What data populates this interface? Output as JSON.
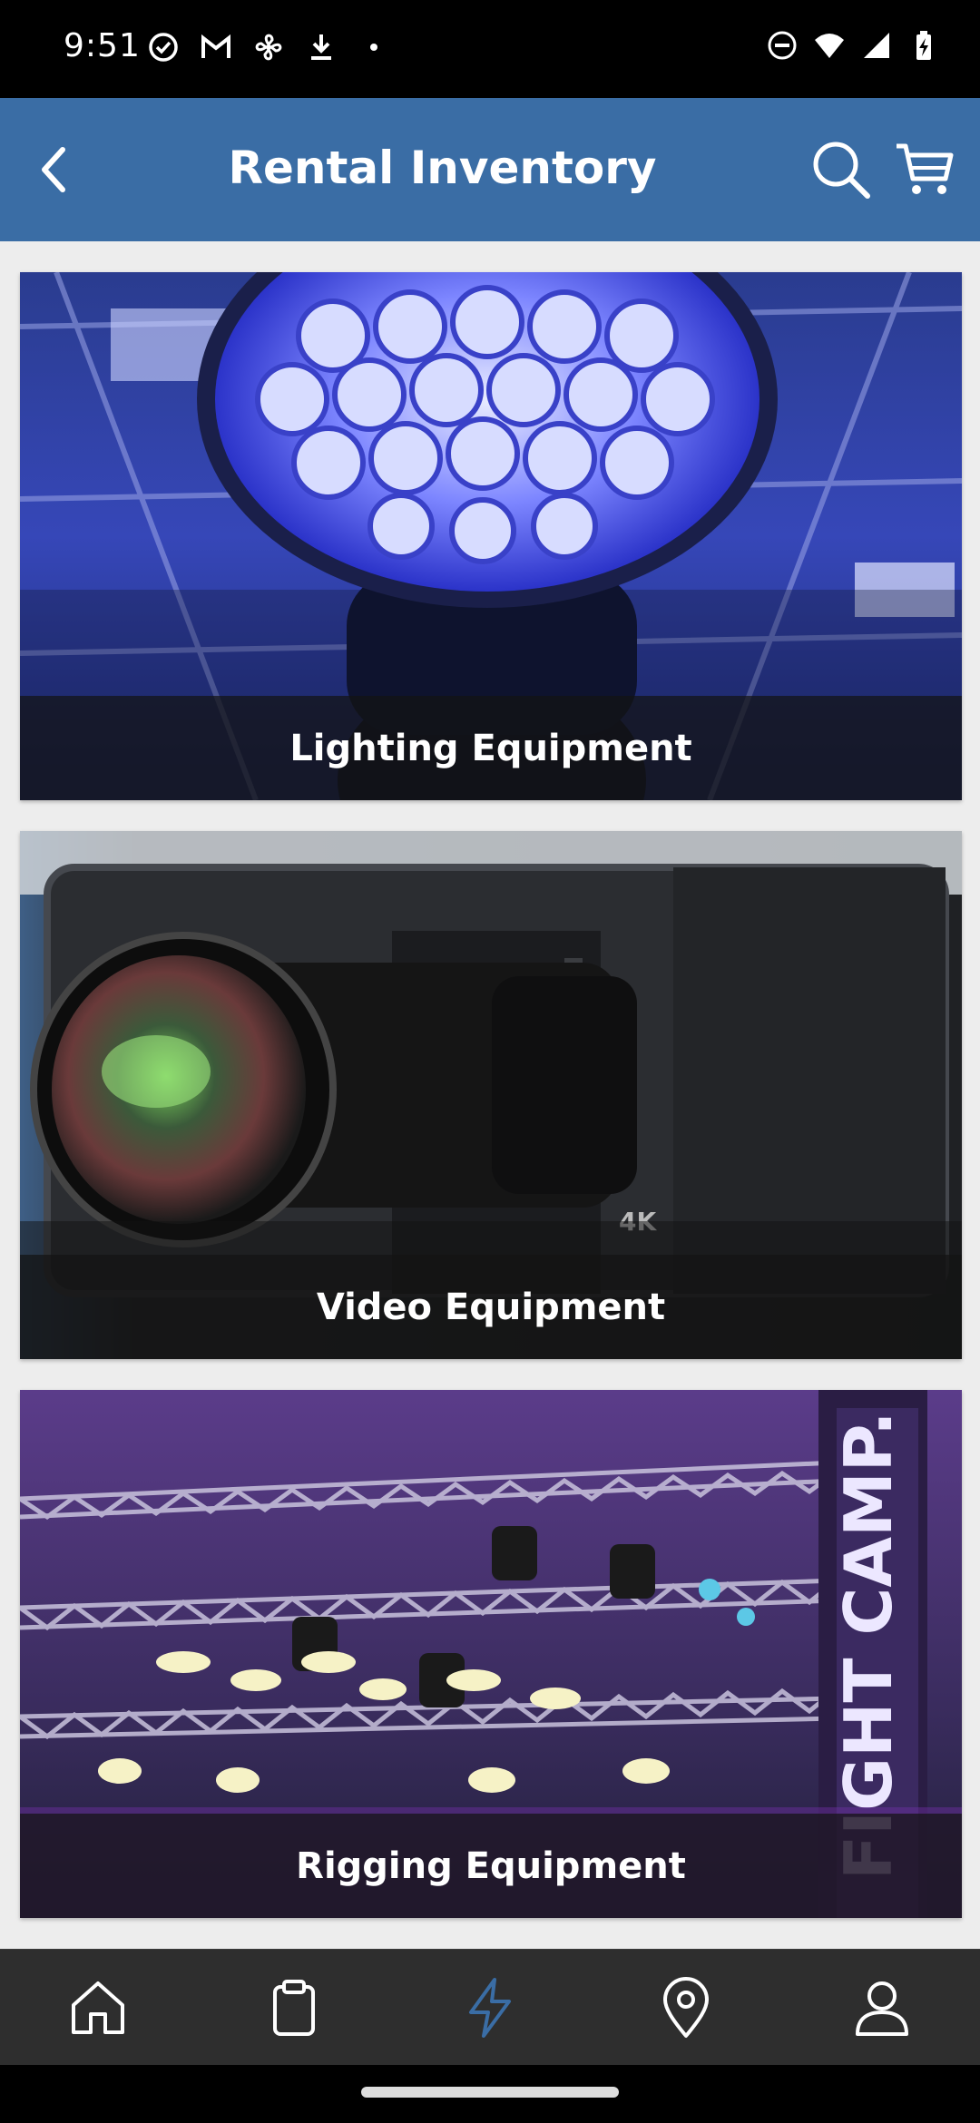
{
  "status_bar": {
    "time": "9:51",
    "left_icons": [
      "check-circle-icon",
      "gmail-icon",
      "fan-icon",
      "download-icon",
      "dot-icon"
    ],
    "right_icons": [
      "do-not-disturb-icon",
      "wifi-icon",
      "signal-icon",
      "battery-charging-icon"
    ]
  },
  "app_bar": {
    "title": "Rental Inventory",
    "background": "#3a6da5",
    "back_icon": "chevron-left-icon",
    "search_icon": "search-icon",
    "cart_icon": "cart-icon"
  },
  "categories": [
    {
      "label": "Lighting Equipment",
      "image": "blue-led-light-fixture"
    },
    {
      "label": "Video Equipment",
      "image": "projector-lens"
    },
    {
      "label": "Rigging Equipment",
      "image": "stage-truss-lights"
    }
  ],
  "bottom_nav": {
    "active_color": "#3a6da5",
    "items": [
      {
        "name": "home",
        "icon": "home-icon",
        "active": false
      },
      {
        "name": "orders",
        "icon": "clipboard-icon",
        "active": false
      },
      {
        "name": "quick",
        "icon": "lightning-icon",
        "active": true
      },
      {
        "name": "location",
        "icon": "location-pin-icon",
        "active": false
      },
      {
        "name": "account",
        "icon": "person-icon",
        "active": false
      }
    ]
  }
}
